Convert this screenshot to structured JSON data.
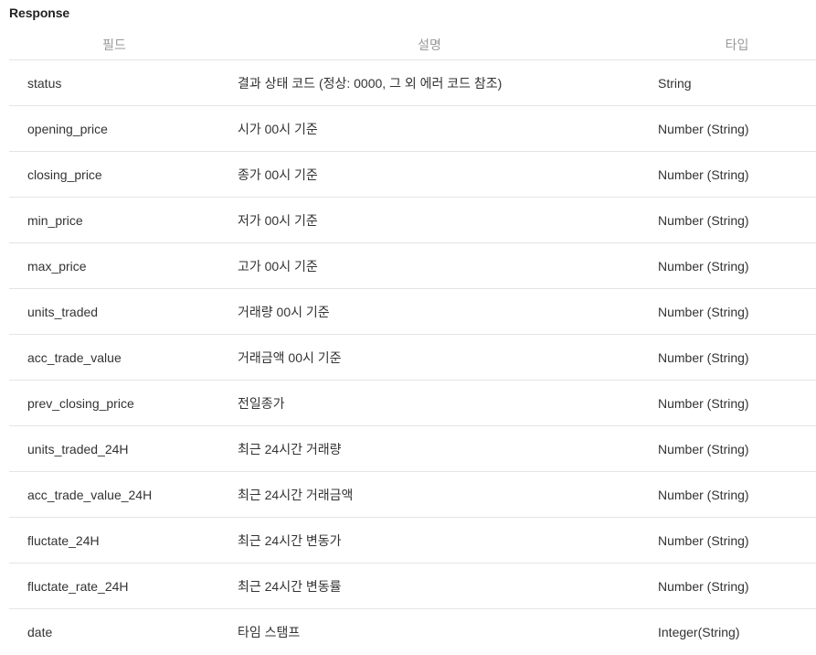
{
  "title": "Response",
  "columns": {
    "field": "필드",
    "description": "설명",
    "type": "타입"
  },
  "rows": [
    {
      "field": "status",
      "description": "결과 상태 코드 (정상: 0000, 그 외 에러 코드 참조)",
      "type": "String"
    },
    {
      "field": "opening_price",
      "description": "시가 00시 기준",
      "type": "Number (String)"
    },
    {
      "field": "closing_price",
      "description": "종가 00시 기준",
      "type": "Number (String)"
    },
    {
      "field": "min_price",
      "description": "저가 00시 기준",
      "type": "Number (String)"
    },
    {
      "field": "max_price",
      "description": "고가 00시 기준",
      "type": "Number (String)"
    },
    {
      "field": "units_traded",
      "description": "거래량 00시 기준",
      "type": "Number (String)"
    },
    {
      "field": "acc_trade_value",
      "description": "거래금액 00시 기준",
      "type": "Number (String)"
    },
    {
      "field": "prev_closing_price",
      "description": "전일종가",
      "type": "Number (String)"
    },
    {
      "field": "units_traded_24H",
      "description": "최근 24시간 거래량",
      "type": "Number (String)"
    },
    {
      "field": "acc_trade_value_24H",
      "description": "최근 24시간 거래금액",
      "type": "Number (String)"
    },
    {
      "field": "fluctate_24H",
      "description": "최근 24시간 변동가",
      "type": "Number (String)"
    },
    {
      "field": "fluctate_rate_24H",
      "description": "최근 24시간 변동률",
      "type": "Number (String)"
    },
    {
      "field": "date",
      "description": "타임 스탬프",
      "type": "Integer(String)"
    }
  ]
}
